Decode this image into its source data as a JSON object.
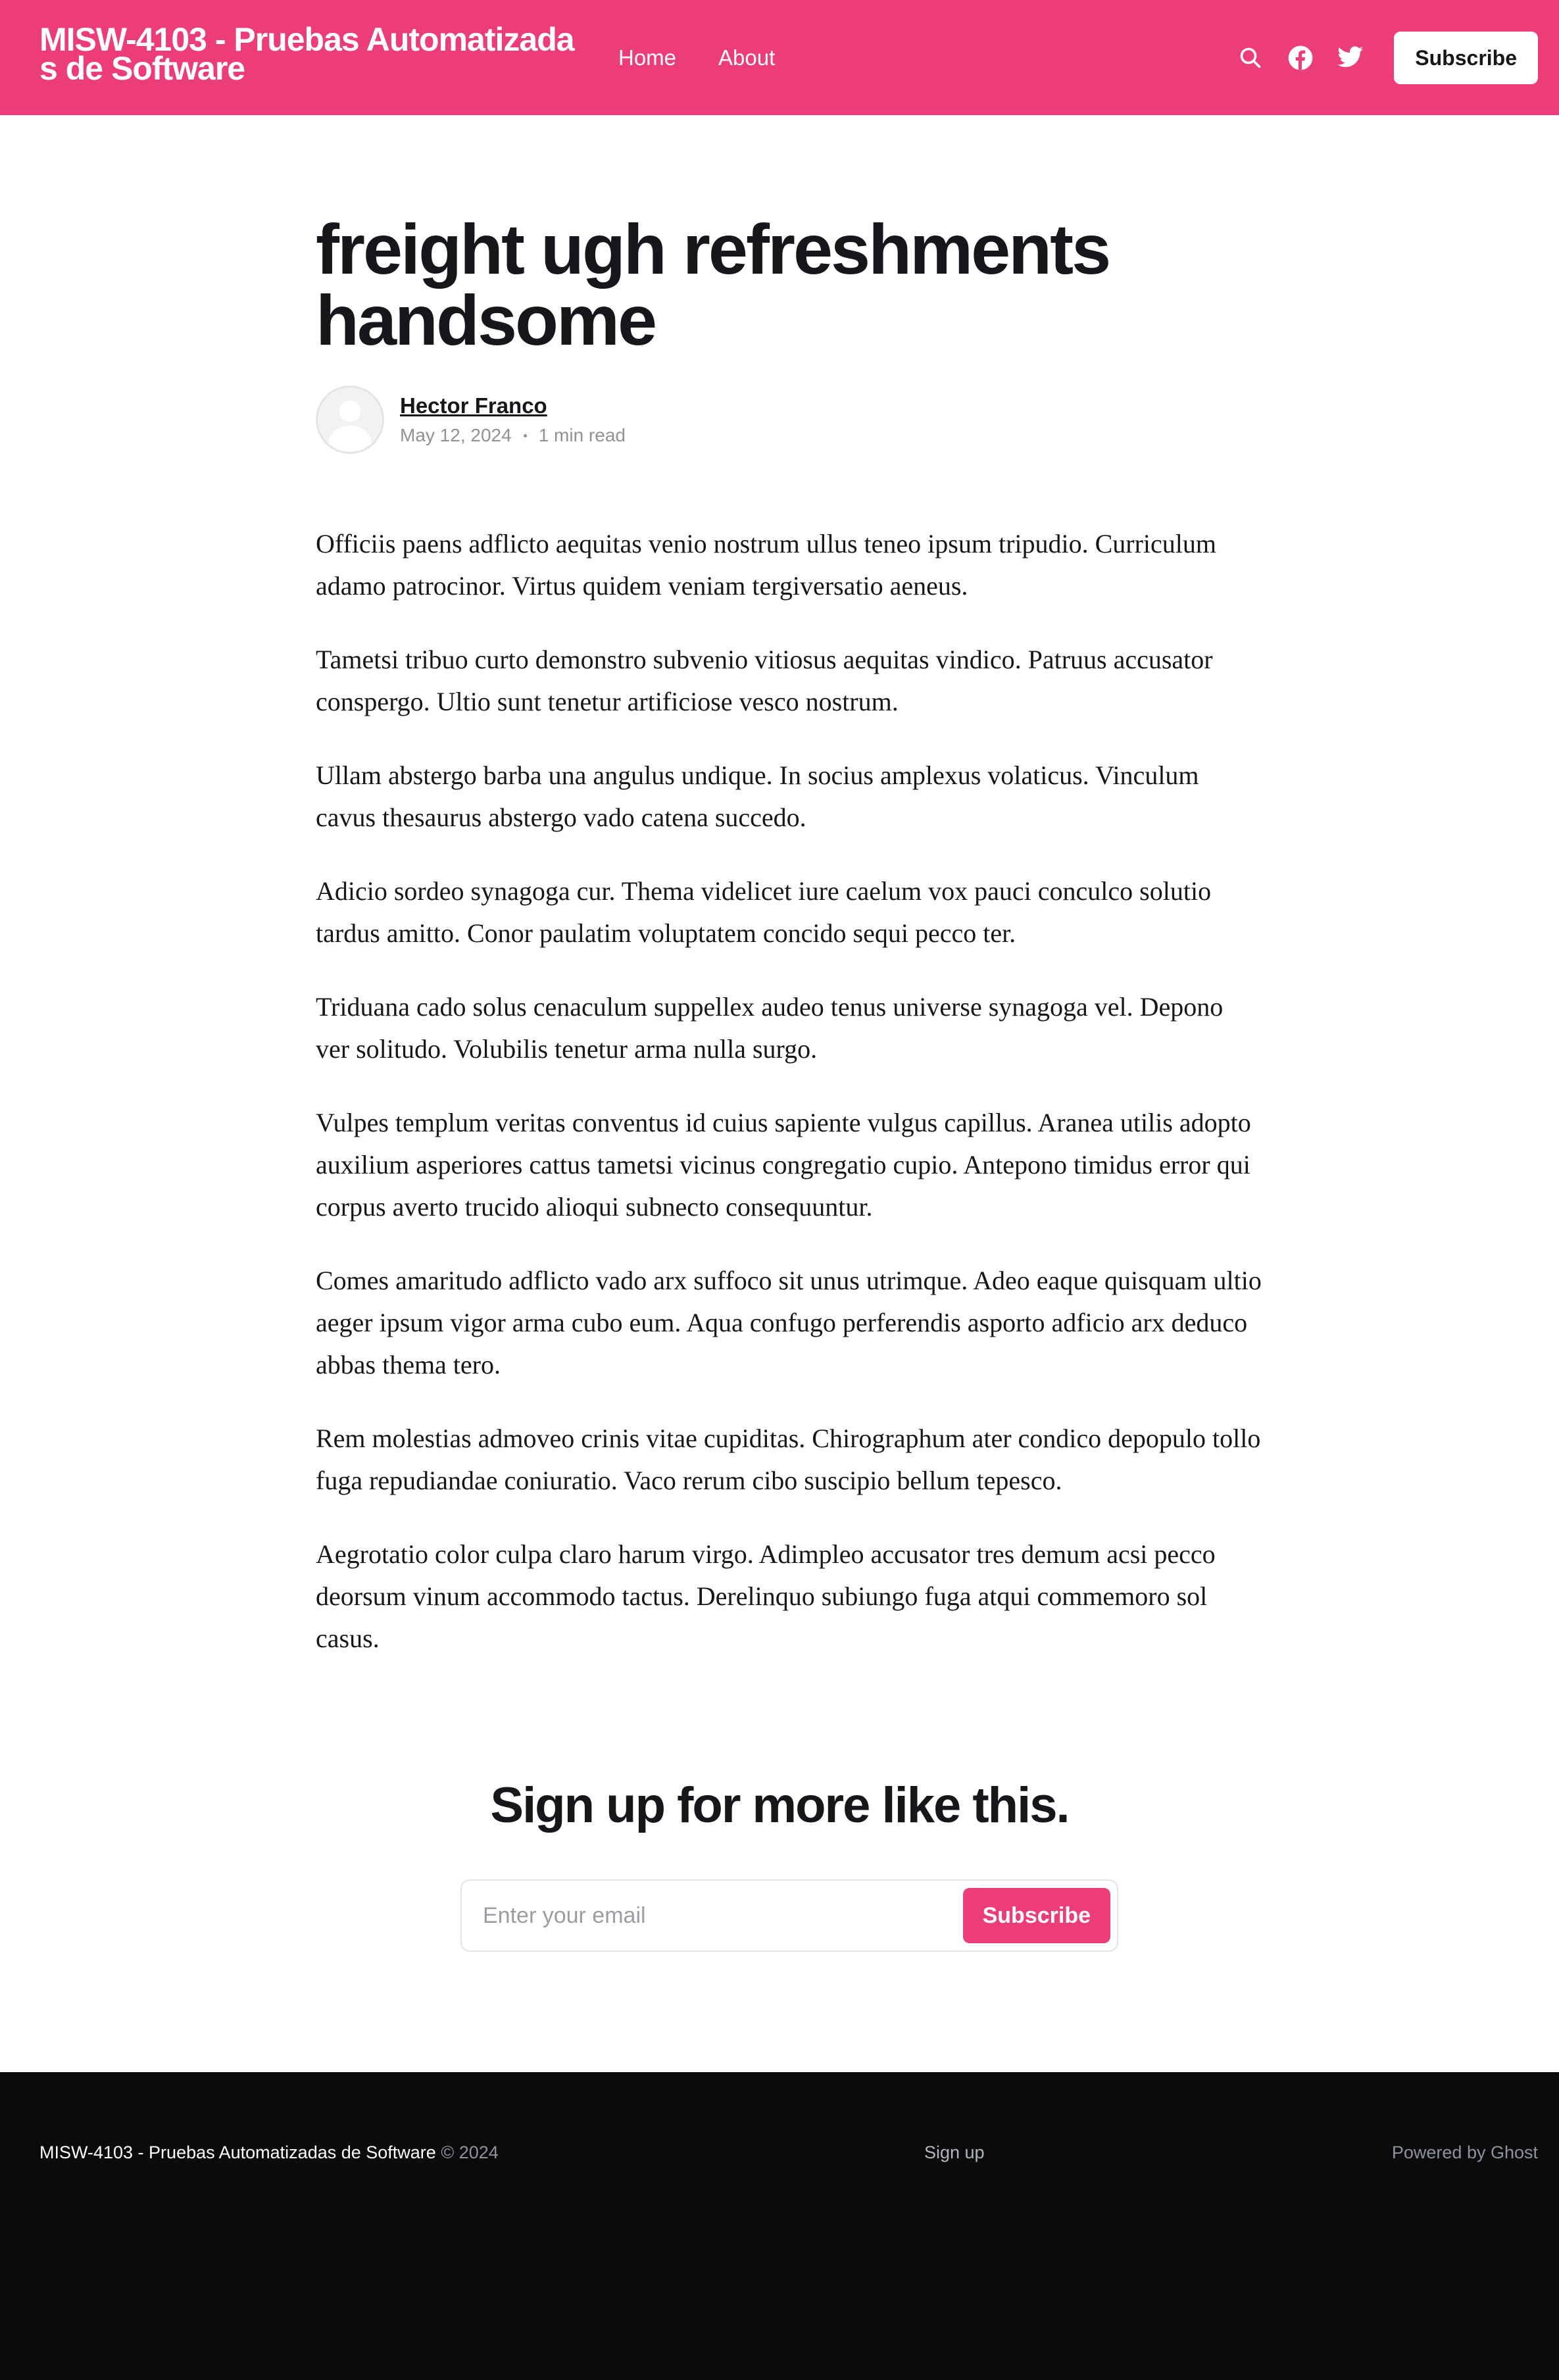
{
  "header": {
    "site_title": "MISW-4103 - Pruebas Automatizadas de Software",
    "nav": [
      {
        "label": "Home"
      },
      {
        "label": "About"
      }
    ],
    "icons": [
      "search-icon",
      "facebook-icon",
      "twitter-icon"
    ],
    "subscribe_label": "Subscribe",
    "accent_color": "#ec3d78"
  },
  "post": {
    "title": "freight ugh refreshments handsome",
    "author": "Hector Franco",
    "date": "May 12, 2024",
    "reading_time": "1 min read",
    "paragraphs": [
      "Officiis paens adflicto aequitas venio nostrum ullus teneo ipsum tripudio. Curriculum adamo patrocinor. Virtus quidem veniam tergiversatio aeneus.",
      "Tametsi tribuo curto demonstro subvenio vitiosus aequitas vindico. Patruus accusator conspergo. Ultio sunt tenetur artificiose vesco nostrum.",
      "Ullam abstergo barba una angulus undique. In socius amplexus volaticus. Vinculum cavus thesaurus abstergo vado catena succedo.",
      "Adicio sordeo synagoga cur. Thema videlicet iure caelum vox pauci conculco solutio tardus amitto. Conor paulatim voluptatem concido sequi pecco ter.",
      "Triduana cado solus cenaculum suppellex audeo tenus universe synagoga vel. Depono ver solitudo. Volubilis tenetur arma nulla surgo.",
      "Vulpes templum veritas conventus id cuius sapiente vulgus capillus. Aranea utilis adopto auxilium asperiores cattus tametsi vicinus congregatio cupio. Antepono timidus error qui corpus averto trucido alioqui subnecto consequuntur.",
      "Comes amaritudo adflicto vado arx suffoco sit unus utrimque. Adeo eaque quisquam ultio aeger ipsum vigor arma cubo eum. Aqua confugo perferendis asporto adficio arx deduco abbas thema tero.",
      "Rem molestias admoveo crinis vitae cupiditas. Chirographum ater condico depopulo tollo fuga repudiandae coniuratio. Vaco rerum cibo suscipio bellum tepesco.",
      "Aegrotatio color culpa claro harum virgo. Adimpleo accusator tres demum acsi pecco deorsum vinum accommodo tactus. Derelinquo subiungo fuga atqui commemoro sol casus."
    ]
  },
  "cta": {
    "title": "Sign up for more like this.",
    "email_placeholder": "Enter your email",
    "button_label": "Subscribe"
  },
  "footer": {
    "site_name": "MISW-4103 - Pruebas Automatizadas de Software",
    "copyright": " © 2024",
    "signup_link": "Sign up",
    "powered_by": "Powered by Ghost",
    "background_color": "#0a0b0d"
  }
}
